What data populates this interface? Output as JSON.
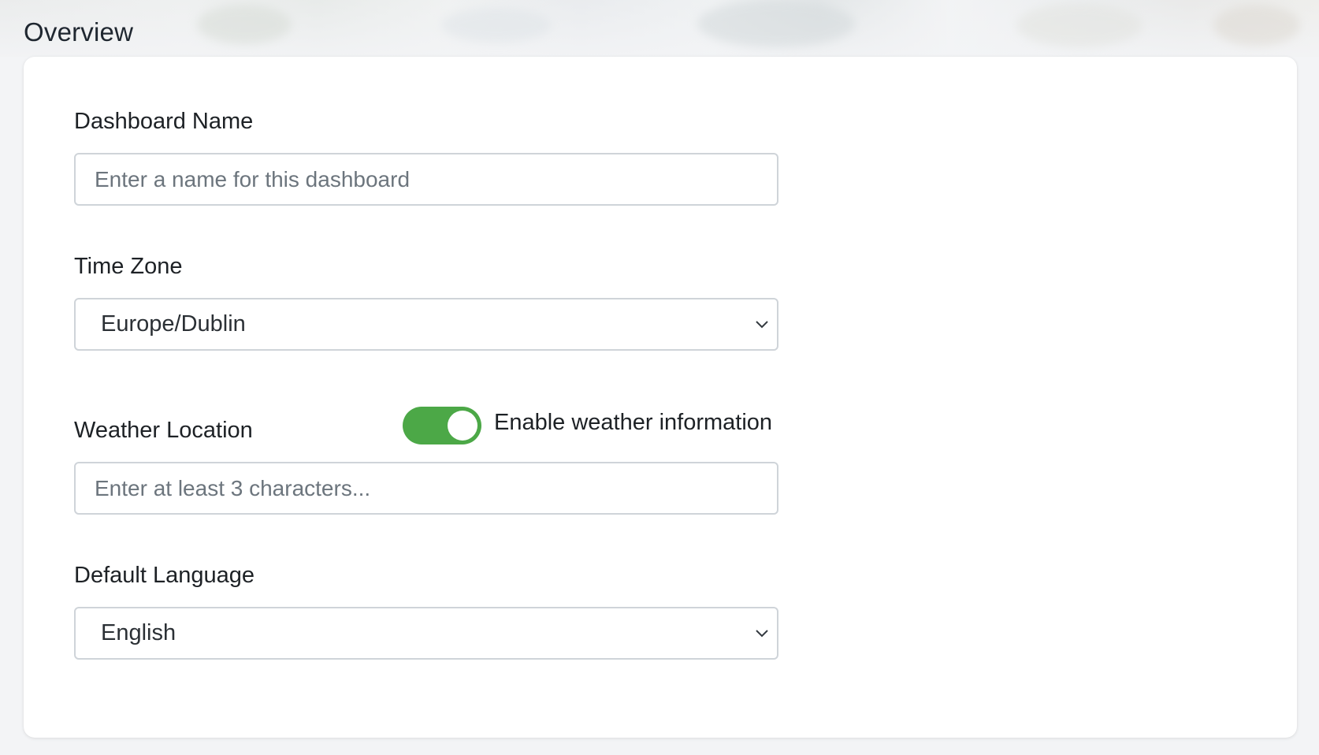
{
  "section": {
    "title": "Overview"
  },
  "form": {
    "dashboard_name": {
      "label": "Dashboard Name",
      "placeholder": "Enter a name for this dashboard",
      "value": ""
    },
    "time_zone": {
      "label": "Time Zone",
      "selected": "Europe/Dublin",
      "icon": "chevron-down-icon"
    },
    "weather": {
      "label": "Weather Location",
      "toggle_label": "Enable weather information",
      "toggle_on": true,
      "toggle_color": "#4ca847",
      "placeholder": "Enter at least 3 characters...",
      "value": ""
    },
    "default_language": {
      "label": "Default Language",
      "selected": "English",
      "icon": "chevron-down-icon"
    }
  }
}
